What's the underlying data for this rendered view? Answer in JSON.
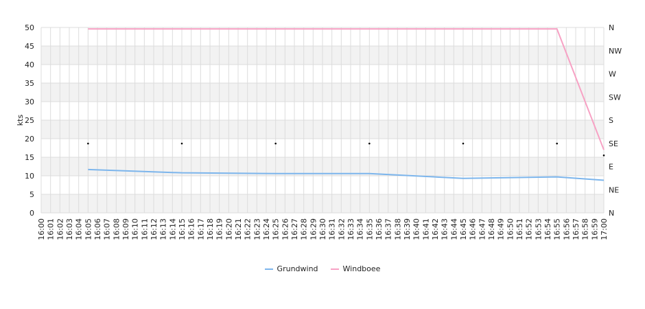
{
  "chart_data": {
    "type": "line",
    "title": "",
    "ylabel": "kts",
    "ylim": [
      0,
      50
    ],
    "yticks": [
      0,
      5,
      10,
      15,
      20,
      25,
      30,
      35,
      40,
      45,
      50
    ],
    "y2_labels": [
      "N",
      "NE",
      "E",
      "SE",
      "S",
      "SW",
      "W",
      "NW",
      "N"
    ],
    "grid": true,
    "legend_position": "bottom",
    "x": [
      "16:00",
      "16:01",
      "16:02",
      "16:03",
      "16:04",
      "16:05",
      "16:06",
      "16:07",
      "16:08",
      "16:09",
      "16:10",
      "16:11",
      "16:12",
      "16:13",
      "16:14",
      "16:15",
      "16:16",
      "16:17",
      "16:18",
      "16:19",
      "16:20",
      "16:21",
      "16:22",
      "16:23",
      "16:24",
      "16:25",
      "16:26",
      "16:27",
      "16:28",
      "16:29",
      "16:30",
      "16:31",
      "16:32",
      "16:33",
      "16:34",
      "16:35",
      "16:36",
      "16:37",
      "16:38",
      "16:39",
      "16:40",
      "16:41",
      "16:42",
      "16:43",
      "16:44",
      "16:45",
      "16:46",
      "16:47",
      "16:48",
      "16:49",
      "16:50",
      "16:51",
      "16:52",
      "16:53",
      "16:54",
      "16:55",
      "16:56",
      "16:57",
      "16:58",
      "16:59",
      "17:00"
    ],
    "series": [
      {
        "name": "Grundwind",
        "color": "#7cb5ec",
        "points": [
          [
            "16:05",
            11.7
          ],
          [
            "16:15",
            10.8
          ],
          [
            "16:25",
            10.6
          ],
          [
            "16:35",
            10.6
          ],
          [
            "16:45",
            9.3
          ],
          [
            "16:55",
            9.7
          ],
          [
            "17:00",
            8.8
          ]
        ]
      },
      {
        "name": "Windboee",
        "color": "#f7a1c4",
        "points": [
          [
            "16:05",
            49.6
          ],
          [
            "16:15",
            49.6
          ],
          [
            "16:25",
            49.6
          ],
          [
            "16:35",
            49.6
          ],
          [
            "16:45",
            49.6
          ],
          [
            "16:55",
            49.6
          ],
          [
            "17:00",
            17.0
          ]
        ]
      }
    ],
    "direction_markers": [
      [
        "16:05",
        18.7
      ],
      [
        "16:15",
        18.7
      ],
      [
        "16:25",
        18.7
      ],
      [
        "16:35",
        18.7
      ],
      [
        "16:45",
        18.7
      ],
      [
        "16:55",
        18.7
      ],
      [
        "17:00",
        15.5
      ]
    ]
  }
}
